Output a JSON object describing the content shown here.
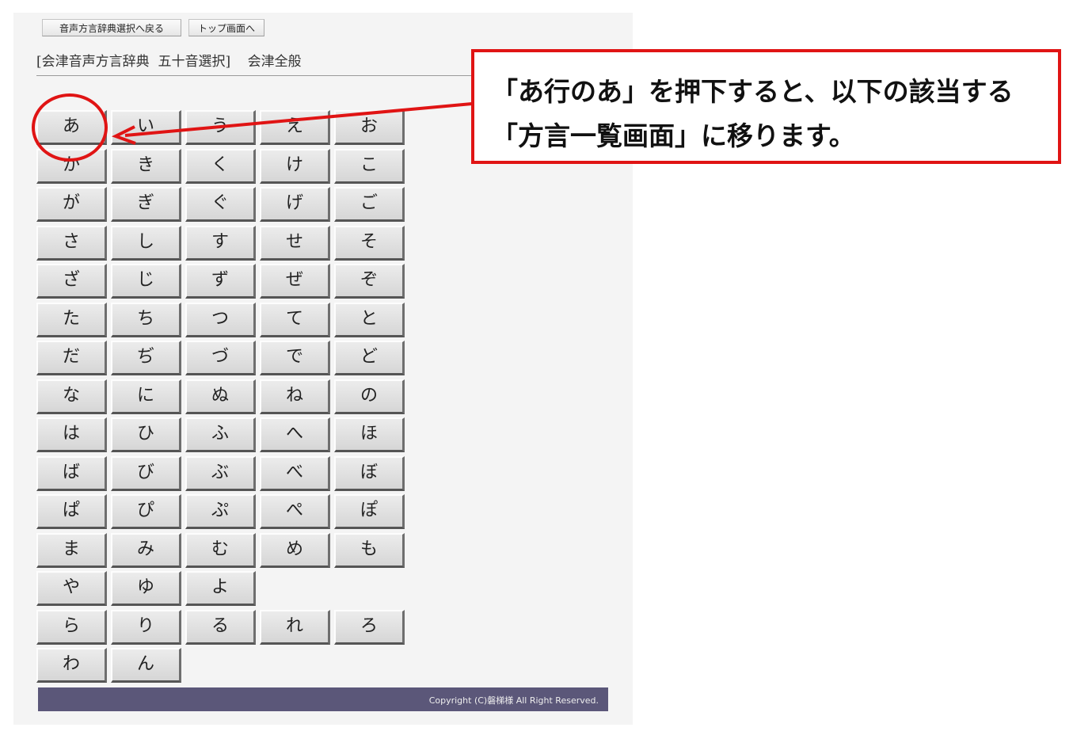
{
  "nav": {
    "back_label": "音声方言辞典選択へ戻る",
    "top_label": "トップ画面へ"
  },
  "page_title": "[会津音声方言辞典  五十音選択]    会津全般",
  "kana_rows": [
    [
      "あ",
      "い",
      "う",
      "え",
      "お"
    ],
    [
      "か",
      "き",
      "く",
      "け",
      "こ"
    ],
    [
      "が",
      "ぎ",
      "ぐ",
      "げ",
      "ご"
    ],
    [
      "さ",
      "し",
      "す",
      "せ",
      "そ"
    ],
    [
      "ざ",
      "じ",
      "ず",
      "ぜ",
      "ぞ"
    ],
    [
      "た",
      "ち",
      "つ",
      "て",
      "と"
    ],
    [
      "だ",
      "ぢ",
      "づ",
      "で",
      "ど"
    ],
    [
      "な",
      "に",
      "ぬ",
      "ね",
      "の"
    ],
    [
      "は",
      "ひ",
      "ふ",
      "へ",
      "ほ"
    ],
    [
      "ば",
      "び",
      "ぶ",
      "べ",
      "ぼ"
    ],
    [
      "ぱ",
      "ぴ",
      "ぷ",
      "ぺ",
      "ぽ"
    ],
    [
      "ま",
      "み",
      "む",
      "め",
      "も"
    ],
    [
      "や",
      "ゆ",
      "よ"
    ],
    [
      "ら",
      "り",
      "る",
      "れ",
      "ろ"
    ],
    [
      "わ",
      "ん"
    ]
  ],
  "footer": {
    "copyright": "Copyright (C)磐梯様  All Right Reserved."
  },
  "callout": {
    "line1": "「あ行のあ」を押下すると、以下の該当する",
    "line2": "「方言一覧画面」に移ります。"
  },
  "colors": {
    "annotation_red": "#e01414",
    "footer_bar": "#5b5779"
  }
}
